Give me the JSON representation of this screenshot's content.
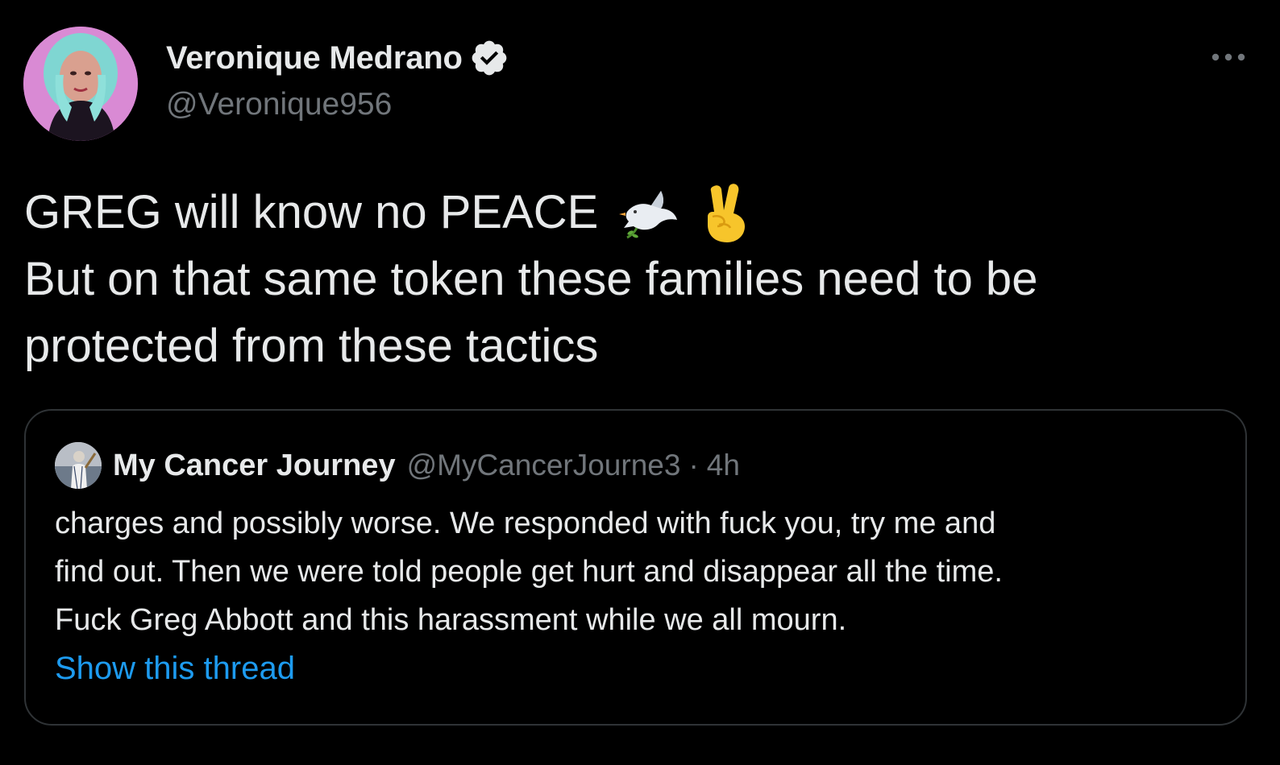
{
  "author": {
    "display_name": "Veronique Medrano",
    "handle": "@Veronique956",
    "verified": true
  },
  "tweet": {
    "lines": [
      "GREG will know no PEACE",
      "But on that same token these families need to be",
      "protected from these tactics"
    ],
    "emojis": [
      "dove-emoji",
      "victory-hand-emoji"
    ]
  },
  "quoted_tweet": {
    "display_name": "My Cancer Journey",
    "handle": "@MyCancerJourne3",
    "separator": "·",
    "time": "4h",
    "lines": [
      "charges and possibly worse. We responded with fuck you, try me and",
      "find out. Then we were told people get hurt and disappear all the time.",
      "Fuck Greg Abbott and this harassment while we all mourn."
    ],
    "show_thread": "Show this thread"
  },
  "colors": {
    "background": "#000000",
    "text_primary": "#e7e9ea",
    "text_secondary": "#71767b",
    "link": "#1d9bf0",
    "border": "#2f3336"
  },
  "icons": {
    "more": "more-horizontal-icon",
    "verified": "verified-badge-icon"
  }
}
